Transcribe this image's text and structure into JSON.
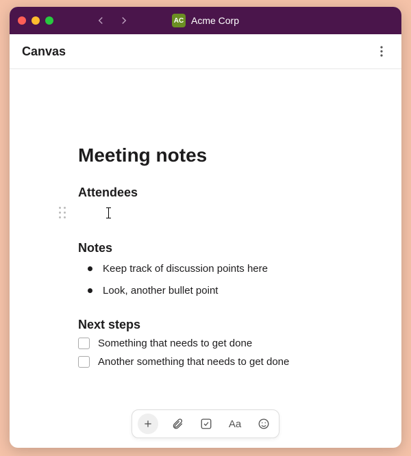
{
  "window": {
    "workspace_abbrev": "AC",
    "workspace_name": "Acme Corp"
  },
  "header": {
    "title": "Canvas"
  },
  "document": {
    "title": "Meeting notes",
    "sections": {
      "attendees": {
        "heading": "Attendees"
      },
      "notes": {
        "heading": "Notes",
        "bullets": [
          "Keep track of discussion points here",
          "Look, another bullet point"
        ]
      },
      "next_steps": {
        "heading": "Next steps",
        "items": [
          {
            "text": "Something that needs to get done",
            "checked": false
          },
          {
            "text": "Another something that needs to get done",
            "checked": false
          }
        ]
      }
    }
  },
  "toolbar": {
    "add": "+",
    "text_format": "Aa"
  }
}
